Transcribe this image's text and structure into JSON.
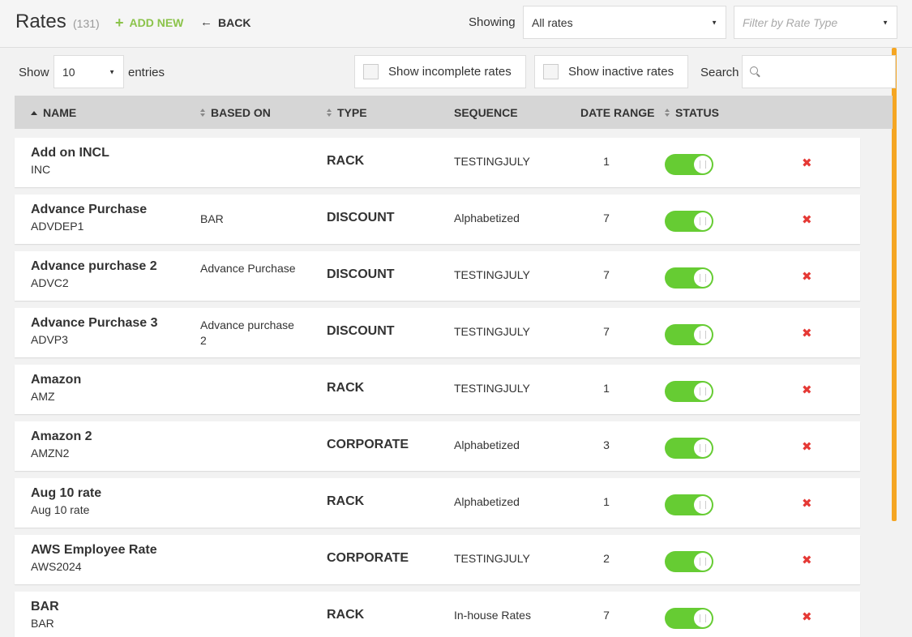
{
  "header": {
    "title": "Rates",
    "count": "(131)",
    "add_new": "ADD NEW",
    "back": "BACK",
    "showing_label": "Showing",
    "rates_select": "All rates",
    "type_filter_placeholder": "Filter by Rate Type"
  },
  "controls": {
    "show_label": "Show",
    "entries_value": "10",
    "entries_label": "entries",
    "incomplete_label": "Show incomplete rates",
    "inactive_label": "Show inactive rates",
    "search_label": "Search",
    "search_value": ""
  },
  "columns": {
    "name": "NAME",
    "based_on": "BASED ON",
    "type": "TYPE",
    "sequence": "SEQUENCE",
    "date_range": "DATE RANGE",
    "status": "STATUS"
  },
  "rows": [
    {
      "name": "Add on INCL",
      "code": "INC",
      "based_on": "",
      "type": "RACK",
      "sequence": "TESTINGJULY",
      "date_range": "1",
      "active": true
    },
    {
      "name": "Advance Purchase",
      "code": "ADVDEP1",
      "based_on": "BAR",
      "type": "DISCOUNT",
      "sequence": "Alphabetized",
      "date_range": "7",
      "active": true
    },
    {
      "name": "Advance purchase 2",
      "code": "ADVC2",
      "based_on": "Advance Purchase",
      "type": "DISCOUNT",
      "sequence": "TESTINGJULY",
      "date_range": "7",
      "active": true
    },
    {
      "name": "Advance Purchase 3",
      "code": "ADVP3",
      "based_on": "Advance purchase 2",
      "type": "DISCOUNT",
      "sequence": "TESTINGJULY",
      "date_range": "7",
      "active": true
    },
    {
      "name": "Amazon",
      "code": "AMZ",
      "based_on": "",
      "type": "RACK",
      "sequence": "TESTINGJULY",
      "date_range": "1",
      "active": true
    },
    {
      "name": "Amazon 2",
      "code": "AMZN2",
      "based_on": "",
      "type": "CORPORATE",
      "sequence": "Alphabetized",
      "date_range": "3",
      "active": true
    },
    {
      "name": "Aug 10 rate",
      "code": "Aug 10 rate",
      "based_on": "",
      "type": "RACK",
      "sequence": "Alphabetized",
      "date_range": "1",
      "active": true
    },
    {
      "name": "AWS Employee Rate",
      "code": "AWS2024",
      "based_on": "",
      "type": "CORPORATE",
      "sequence": "TESTINGJULY",
      "date_range": "2",
      "active": true
    },
    {
      "name": "BAR",
      "code": "BAR",
      "based_on": "",
      "type": "RACK",
      "sequence": "In-house Rates",
      "date_range": "7",
      "active": true
    }
  ],
  "colors": {
    "accent_green": "#8bc34a",
    "toggle_on": "#66cc33",
    "delete_red": "#e53935",
    "scroll_orange": "#f5a623"
  },
  "icons": {
    "add": "plus-icon",
    "back": "arrow-left-icon",
    "search": "magnifier-icon",
    "delete": "x-icon"
  }
}
